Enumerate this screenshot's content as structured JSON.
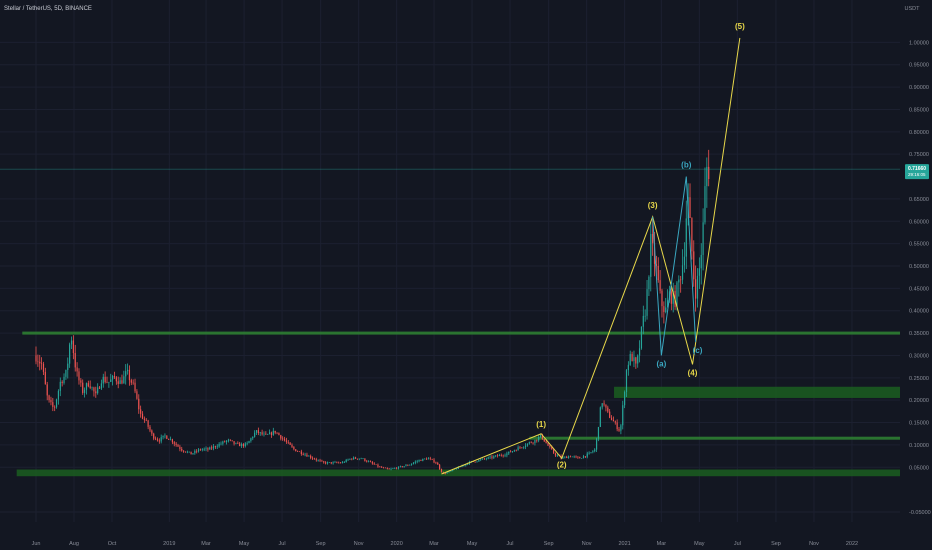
{
  "header": {
    "title": "Stellar / TetherUS, 5D, BINANCE",
    "currency": "USDT"
  },
  "colors": {
    "background": "#131722",
    "grid": "#1c2030",
    "candle_up": "#26a69a",
    "candle_down": "#ef5350",
    "support_zone": "#1b5e20",
    "support_line": "#2e7d32",
    "impulse": "#e8d84a",
    "corrective": "#3aa8c1",
    "price_tag": "#26a69a",
    "price_line": "#26a69a"
  },
  "chart_data": {
    "type": "candlestick",
    "title": "Stellar / TetherUS, 5D, BINANCE",
    "x_range": [
      "2018-06-01",
      "2022-02-15"
    ],
    "ylim": [
      -0.05,
      1.05
    ],
    "yticks": [
      {
        "value": -0.05,
        "label": "-0.05000"
      },
      {
        "value": 0.05,
        "label": "0.05000"
      },
      {
        "value": 0.1,
        "label": "0.10000"
      },
      {
        "value": 0.15,
        "label": "0.15000"
      },
      {
        "value": 0.2,
        "label": "0.20000"
      },
      {
        "value": 0.25,
        "label": "0.25000"
      },
      {
        "value": 0.3,
        "label": "0.30000"
      },
      {
        "value": 0.35,
        "label": "0.35000"
      },
      {
        "value": 0.4,
        "label": "0.40000"
      },
      {
        "value": 0.45,
        "label": "0.45000"
      },
      {
        "value": 0.5,
        "label": "0.50000"
      },
      {
        "value": 0.55,
        "label": "0.55000"
      },
      {
        "value": 0.6,
        "label": "0.60000"
      },
      {
        "value": 0.65,
        "label": "0.65000"
      },
      {
        "value": 0.75,
        "label": "0.75000"
      },
      {
        "value": 0.8,
        "label": "0.80000"
      },
      {
        "value": 0.85,
        "label": "0.85000"
      },
      {
        "value": 0.9,
        "label": "0.90000"
      },
      {
        "value": 0.95,
        "label": "0.95000"
      },
      {
        "value": 1.0,
        "label": "1.00000"
      }
    ],
    "xticks": [
      {
        "date": "2018-06-01",
        "label": "Jun"
      },
      {
        "date": "2018-08-01",
        "label": "Aug"
      },
      {
        "date": "2018-10-01",
        "label": "Oct"
      },
      {
        "date": "2019-01-01",
        "label": "2019"
      },
      {
        "date": "2019-03-01",
        "label": "Mar"
      },
      {
        "date": "2019-05-01",
        "label": "May"
      },
      {
        "date": "2019-07-01",
        "label": "Jul"
      },
      {
        "date": "2019-09-01",
        "label": "Sep"
      },
      {
        "date": "2019-11-01",
        "label": "Nov"
      },
      {
        "date": "2020-01-01",
        "label": "2020"
      },
      {
        "date": "2020-03-01",
        "label": "Mar"
      },
      {
        "date": "2020-05-01",
        "label": "May"
      },
      {
        "date": "2020-07-01",
        "label": "Jul"
      },
      {
        "date": "2020-09-01",
        "label": "Sep"
      },
      {
        "date": "2020-11-01",
        "label": "Nov"
      },
      {
        "date": "2021-01-01",
        "label": "2021"
      },
      {
        "date": "2021-03-01",
        "label": "Mar"
      },
      {
        "date": "2021-05-01",
        "label": "May"
      },
      {
        "date": "2021-07-01",
        "label": "Jul"
      },
      {
        "date": "2021-09-01",
        "label": "Sep"
      },
      {
        "date": "2021-11-01",
        "label": "Nov"
      },
      {
        "date": "2022-01-01",
        "label": "2022"
      }
    ],
    "current_price": {
      "value": 0.7166,
      "label": "0.71660",
      "countdown": "29:16:05"
    },
    "price_path": [
      [
        "2018-06-01",
        0.3
      ],
      [
        "2018-06-10",
        0.28
      ],
      [
        "2018-06-20",
        0.2
      ],
      [
        "2018-06-30",
        0.18
      ],
      [
        "2018-07-10",
        0.24
      ],
      [
        "2018-07-20",
        0.26
      ],
      [
        "2018-07-27",
        0.35
      ],
      [
        "2018-08-05",
        0.26
      ],
      [
        "2018-08-15",
        0.22
      ],
      [
        "2018-08-25",
        0.24
      ],
      [
        "2018-09-05",
        0.21
      ],
      [
        "2018-09-15",
        0.25
      ],
      [
        "2018-09-25",
        0.24
      ],
      [
        "2018-10-05",
        0.25
      ],
      [
        "2018-10-15",
        0.24
      ],
      [
        "2018-10-25",
        0.26
      ],
      [
        "2018-11-05",
        0.23
      ],
      [
        "2018-11-15",
        0.17
      ],
      [
        "2018-11-25",
        0.15
      ],
      [
        "2018-12-05",
        0.12
      ],
      [
        "2018-12-15",
        0.11
      ],
      [
        "2018-12-25",
        0.12
      ],
      [
        "2019-01-05",
        0.11
      ],
      [
        "2019-01-20",
        0.09
      ],
      [
        "2019-02-05",
        0.08
      ],
      [
        "2019-02-20",
        0.09
      ],
      [
        "2019-03-05",
        0.09
      ],
      [
        "2019-03-20",
        0.1
      ],
      [
        "2019-04-05",
        0.11
      ],
      [
        "2019-04-20",
        0.1
      ],
      [
        "2019-05-05",
        0.1
      ],
      [
        "2019-05-20",
        0.13
      ],
      [
        "2019-06-05",
        0.12
      ],
      [
        "2019-06-20",
        0.13
      ],
      [
        "2019-07-05",
        0.11
      ],
      [
        "2019-07-20",
        0.09
      ],
      [
        "2019-08-05",
        0.08
      ],
      [
        "2019-08-20",
        0.07
      ],
      [
        "2019-09-05",
        0.06
      ],
      [
        "2019-09-20",
        0.06
      ],
      [
        "2019-10-05",
        0.06
      ],
      [
        "2019-10-20",
        0.07
      ],
      [
        "2019-11-05",
        0.07
      ],
      [
        "2019-11-20",
        0.06
      ],
      [
        "2019-12-05",
        0.05
      ],
      [
        "2019-12-20",
        0.045
      ],
      [
        "2020-01-05",
        0.05
      ],
      [
        "2020-01-20",
        0.055
      ],
      [
        "2020-02-05",
        0.065
      ],
      [
        "2020-02-20",
        0.07
      ],
      [
        "2020-03-05",
        0.06
      ],
      [
        "2020-03-15",
        0.035
      ],
      [
        "2020-03-25",
        0.04
      ],
      [
        "2020-04-10",
        0.05
      ],
      [
        "2020-04-25",
        0.06
      ],
      [
        "2020-05-10",
        0.065
      ],
      [
        "2020-05-25",
        0.07
      ],
      [
        "2020-06-10",
        0.075
      ],
      [
        "2020-06-25",
        0.08
      ],
      [
        "2020-07-10",
        0.09
      ],
      [
        "2020-07-25",
        0.1
      ],
      [
        "2020-08-10",
        0.11
      ],
      [
        "2020-08-20",
        0.12
      ],
      [
        "2020-08-30",
        0.1
      ],
      [
        "2020-09-10",
        0.08
      ],
      [
        "2020-09-22",
        0.07
      ],
      [
        "2020-10-05",
        0.075
      ],
      [
        "2020-10-20",
        0.07
      ],
      [
        "2020-11-05",
        0.08
      ],
      [
        "2020-11-15",
        0.09
      ],
      [
        "2020-11-25",
        0.2
      ],
      [
        "2020-12-05",
        0.17
      ],
      [
        "2020-12-15",
        0.15
      ],
      [
        "2020-12-25",
        0.13
      ],
      [
        "2021-01-05",
        0.28
      ],
      [
        "2021-01-12",
        0.3
      ],
      [
        "2021-01-20",
        0.27
      ],
      [
        "2021-01-28",
        0.35
      ],
      [
        "2021-02-05",
        0.42
      ],
      [
        "2021-02-12",
        0.55
      ],
      [
        "2021-02-20",
        0.5
      ],
      [
        "2021-02-28",
        0.42
      ],
      [
        "2021-03-08",
        0.4
      ],
      [
        "2021-03-15",
        0.44
      ],
      [
        "2021-03-22",
        0.42
      ],
      [
        "2021-03-30",
        0.47
      ],
      [
        "2021-04-06",
        0.52
      ],
      [
        "2021-04-12",
        0.66
      ],
      [
        "2021-04-18",
        0.55
      ],
      [
        "2021-04-24",
        0.44
      ],
      [
        "2021-04-30",
        0.48
      ],
      [
        "2021-05-06",
        0.56
      ],
      [
        "2021-05-12",
        0.72
      ],
      [
        "2021-05-16",
        0.7166
      ]
    ],
    "support_zones": [
      {
        "name": "zone-1",
        "y_low": 0.03,
        "y_high": 0.045,
        "x_start": "2018-05-01"
      },
      {
        "name": "zone-2",
        "y_low": 0.205,
        "y_high": 0.23,
        "x_start": "2020-12-15"
      }
    ],
    "support_lines": [
      {
        "name": "line-1",
        "y": 0.35,
        "x_start": "2018-05-10"
      },
      {
        "name": "line-2",
        "y": 0.115,
        "x_start": "2020-08-01"
      }
    ],
    "impulse_wave": {
      "points": [
        [
          "2020-03-13",
          0.035
        ],
        [
          "2020-08-20",
          0.125
        ],
        [
          "2020-09-22",
          0.07
        ],
        [
          "2021-02-15",
          0.61
        ],
        [
          "2021-04-20",
          0.28
        ],
        [
          "2021-07-05",
          1.01
        ]
      ],
      "labels": [
        {
          "text": "(1)",
          "date": "2020-08-20",
          "value": 0.14
        },
        {
          "text": "(2)",
          "date": "2020-09-22",
          "value": 0.05
        },
        {
          "text": "(3)",
          "date": "2021-02-15",
          "value": 0.63
        },
        {
          "text": "(4)",
          "date": "2021-04-20",
          "value": 0.255
        },
        {
          "text": "(5)",
          "date": "2021-07-05",
          "value": 1.03
        }
      ]
    },
    "corrective_wave": {
      "points": [
        [
          "2021-02-15",
          0.61
        ],
        [
          "2021-03-01",
          0.3
        ],
        [
          "2021-04-10",
          0.7
        ],
        [
          "2021-04-25",
          0.33
        ]
      ],
      "labels": [
        {
          "text": "(a)",
          "date": "2021-03-01",
          "value": 0.275
        },
        {
          "text": "(b)",
          "date": "2021-04-10",
          "value": 0.72
        },
        {
          "text": "(c)",
          "date": "2021-04-28",
          "value": 0.305
        }
      ]
    }
  }
}
